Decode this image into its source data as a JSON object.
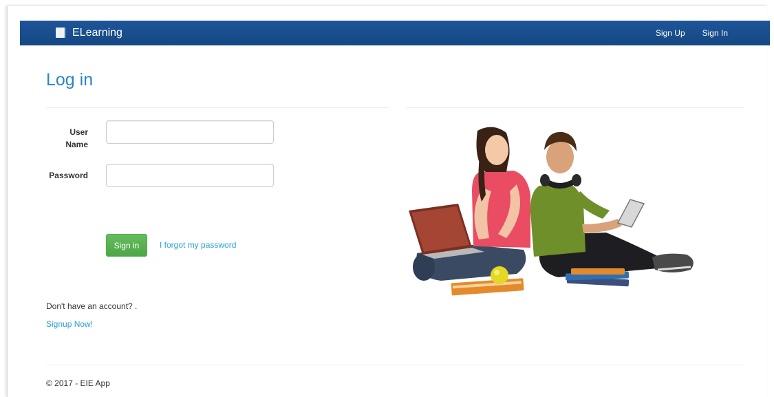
{
  "navbar": {
    "brand_icon": "book-icon",
    "brand": "ELearning",
    "links": [
      "Sign Up",
      "Sign In"
    ],
    "color": "#1a4f91"
  },
  "page": {
    "title": "Log in"
  },
  "form": {
    "username_label": "User Name",
    "username_value": "",
    "password_label": "Password",
    "password_value": "",
    "signin_button": "Sign in",
    "forgot_link": "I forgot my password"
  },
  "signup": {
    "prompt": "Don't have an account? .",
    "link": "Signup Now!"
  },
  "footer": {
    "text": "© 2017 - EIE App"
  },
  "colors": {
    "accent": "#2a85c3",
    "link": "#2a9fd6",
    "success": "#5cb85c"
  }
}
